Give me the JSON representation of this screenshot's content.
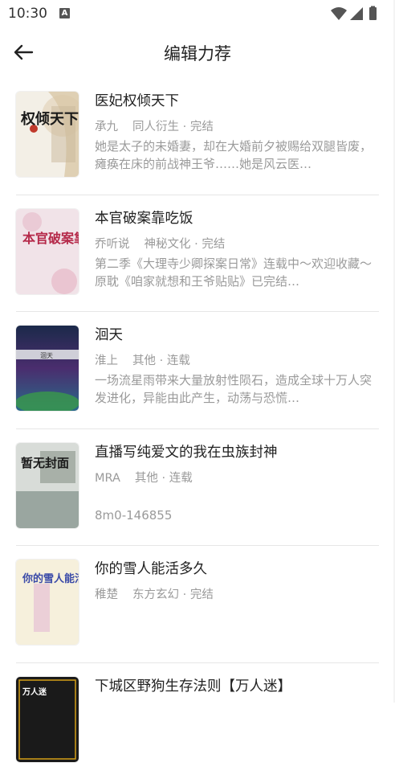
{
  "status": {
    "time": "10:30",
    "badge": "A"
  },
  "header": {
    "title": "编辑力荐"
  },
  "books": [
    {
      "title": "医妃权倾天下",
      "author": "承九",
      "category": "同人衍生 · 完结",
      "desc": "她是太子的未婚妻，却在大婚前夕被赐给双腿皆废，瘫痪在床的前战神王爷……她是风云医…",
      "cover_text": "权倾天下"
    },
    {
      "title": "本官破案靠吃饭",
      "author": "乔听说",
      "category": "神秘文化 · 完结",
      "desc": "第二季《大理寺少卿探案日常》连载中～欢迎收藏～原耽《咱家就想和王爷贴贴》已完结…",
      "cover_text": "本官破案靠吃饭"
    },
    {
      "title": "洄天",
      "author": "淮上",
      "category": "其他 · 连载",
      "desc": "一场流星雨带来大量放射性陨石，造成全球十万人突发进化，异能由此产生，动荡与恐慌…",
      "cover_text": "洄天"
    },
    {
      "title": "直播写纯爱文的我在虫族封神",
      "author": "MRA",
      "category": "其他 · 连载",
      "desc": "8m0-146855",
      "cover_text": "暂无封面"
    },
    {
      "title": "你的雪人能活多久",
      "author": "稚楚",
      "category": "东方玄幻 · 完结",
      "desc": "",
      "cover_text": "你的雪人能活多久"
    },
    {
      "title": "下城区野狗生存法则【万人迷】",
      "author": "",
      "category": "",
      "desc": "",
      "cover_text": "万人迷"
    }
  ]
}
